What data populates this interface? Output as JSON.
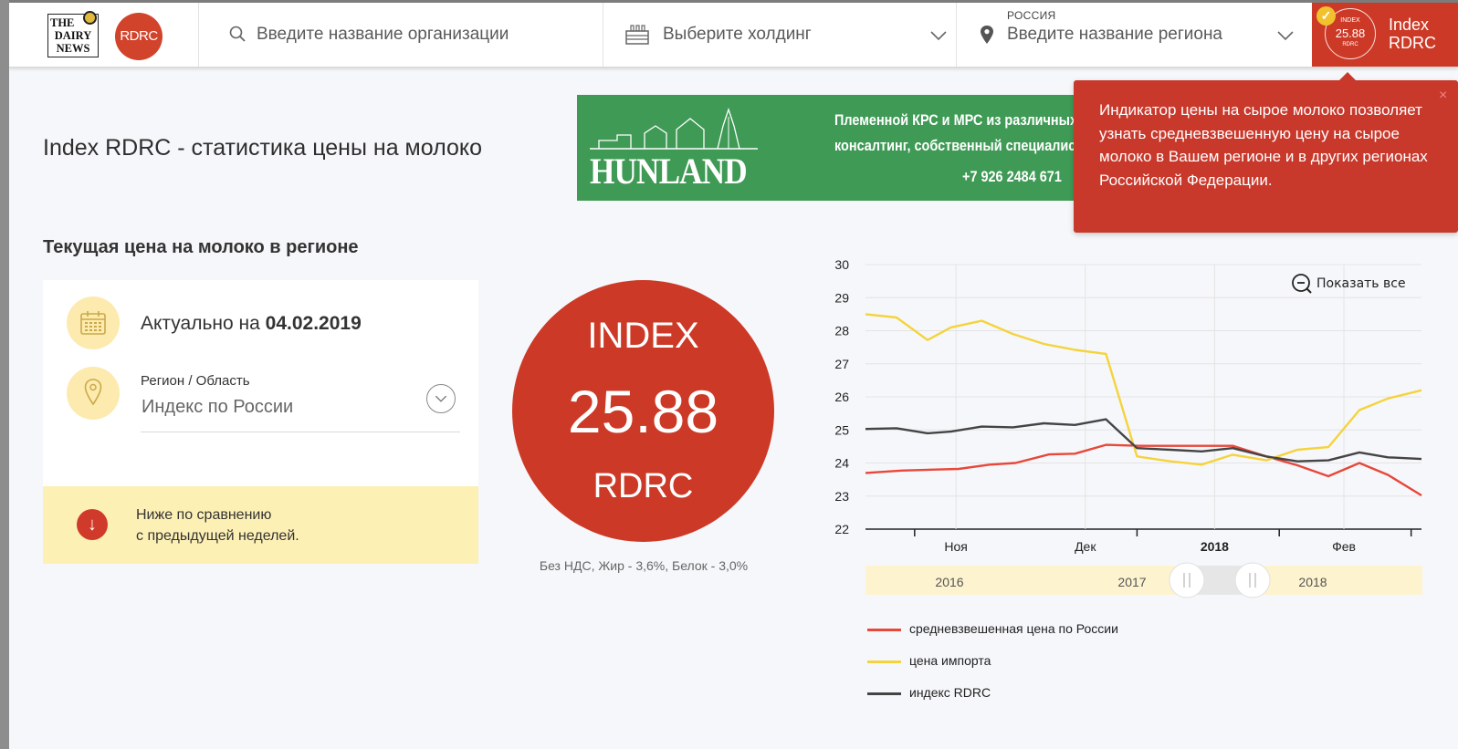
{
  "header": {
    "logo_text_lines": [
      "THE",
      "DAIRY",
      "NEWS"
    ],
    "logo_rdrc": "RDRC",
    "search_placeholder": "Введите название организации",
    "holding_placeholder": "Выберите холдинг",
    "region_country": "РОССИЯ",
    "region_placeholder": "Введите название региона",
    "index_mini": {
      "top": "INDEX",
      "value": "25.88",
      "bottom": "RDRC"
    },
    "index_label_lines": [
      "Index",
      "RDRC"
    ]
  },
  "page": {
    "title": "Index RDRC - статистика цены на молоко",
    "section_title": "Текущая цена на молоко в регионе"
  },
  "banner": {
    "brand": "HUNLAND",
    "line1": "Племенной КРС и МРС из различных",
    "line2": "консалтинг, собственный специалист",
    "line3": "+7 926 2484 671"
  },
  "tooltip": {
    "text": "Индикатор цены на сырое молоко позволяет узнать средневзвешенную цену на сырое молоко в Вашем регионе и в других регионах Российской Федерации.",
    "close": "×"
  },
  "card": {
    "actual_prefix": "Актуально на ",
    "actual_date": "04.02.2019",
    "region_label": "Регион / Область",
    "region_value": "Индекс по России",
    "compare_line1": "Ниже по сравнению",
    "compare_line2": "с предыдущей неделей.",
    "compare_arrow": "↓"
  },
  "index_circle": {
    "top": "INDEX",
    "value": "25.88",
    "bottom": "RDRC",
    "note": "Без НДС, Жир - 3,6%, Белок - 3,0%"
  },
  "chart_controls": {
    "zoom_label": "Показать все",
    "navigator_years": [
      "2016",
      "2017",
      "2018"
    ]
  },
  "colors": {
    "russia_price": "#e8473a",
    "import_price": "#f5d33c",
    "rdrc_index": "#444444",
    "brand_red": "#cc3a27"
  },
  "chart_data": {
    "type": "line",
    "y_ticks": [
      "22",
      "23",
      "24",
      "25",
      "26",
      "27",
      "28",
      "29",
      "30"
    ],
    "ylim": [
      22,
      30
    ],
    "x_tick_labels": [
      "Ноя",
      "Дек",
      "2018",
      "Фев"
    ],
    "x_tick_positions": [
      3.5,
      8.5,
      13.5,
      18.5
    ],
    "xlim": [
      0,
      21.5
    ],
    "series": [
      {
        "name": "средневзвешенная цена по России",
        "x": [
          0,
          1.4,
          2.7,
          3.6,
          4.8,
          5.8,
          7.1,
          8.1,
          9.3,
          10.6,
          11.8,
          13.2,
          14.2,
          15.5,
          16.7,
          17.9,
          19.1,
          20.2,
          21.5
        ],
        "values": [
          23.7,
          23.77,
          23.8,
          23.82,
          23.95,
          24.0,
          24.26,
          24.28,
          24.55,
          24.52,
          24.52,
          24.52,
          24.52,
          24.2,
          23.93,
          23.6,
          24.0,
          23.64,
          23.02
        ]
      },
      {
        "name": "цена импорта",
        "x": [
          0,
          1.2,
          2.4,
          3.3,
          4.5,
          5.7,
          6.9,
          8.1,
          9.3,
          10.5,
          11.8,
          13.0,
          14.2,
          15.5,
          16.7,
          17.9,
          19.1,
          20.2,
          21.5
        ],
        "values": [
          28.5,
          28.4,
          27.72,
          28.1,
          28.3,
          27.9,
          27.6,
          27.42,
          27.3,
          24.2,
          24.05,
          23.95,
          24.25,
          24.08,
          24.4,
          24.48,
          25.6,
          25.95,
          26.2
        ]
      },
      {
        "name": "индекс RDRC",
        "x": [
          0,
          1.2,
          2.4,
          3.3,
          4.5,
          5.7,
          6.9,
          8.1,
          9.3,
          10.5,
          11.8,
          13.0,
          14.2,
          15.5,
          16.7,
          17.9,
          19.1,
          20.2,
          21.5
        ],
        "values": [
          25.03,
          25.05,
          24.9,
          24.95,
          25.1,
          25.08,
          25.2,
          25.15,
          25.32,
          24.45,
          24.4,
          24.35,
          24.45,
          24.2,
          24.05,
          24.08,
          24.32,
          24.17,
          24.12
        ]
      }
    ]
  }
}
